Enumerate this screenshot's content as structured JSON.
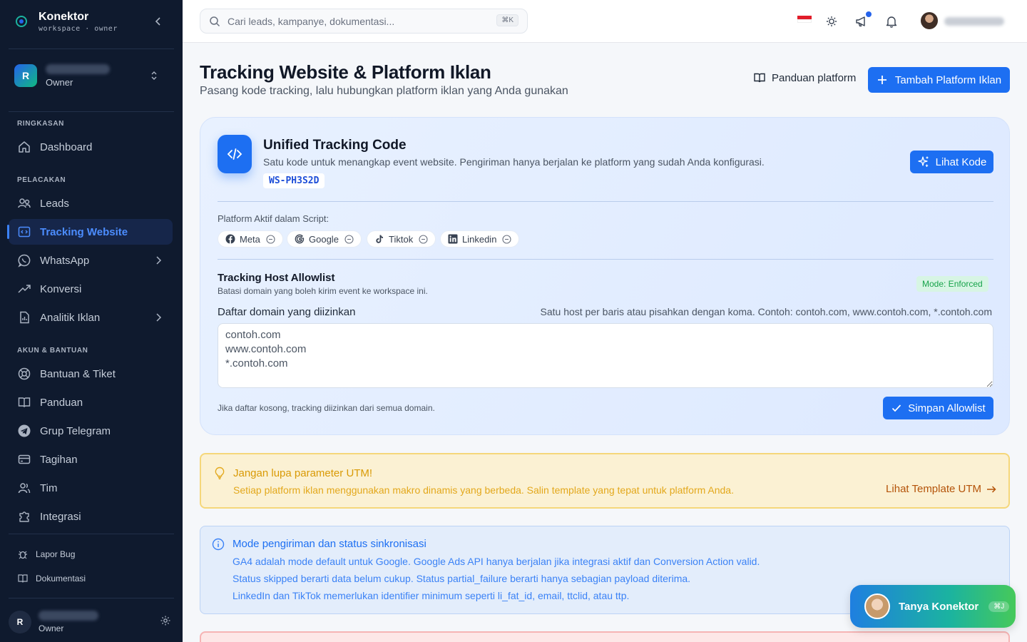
{
  "brand": {
    "name": "Konektor",
    "sub": "workspace · owner"
  },
  "workspace": {
    "initial": "R",
    "role": "Owner"
  },
  "sidebar": {
    "sections": [
      "RINGKASAN",
      "PELACAKAN",
      "AKUN & BANTUAN"
    ],
    "items": [
      {
        "label": "Dashboard",
        "icon": "home-icon"
      },
      {
        "label": "Leads",
        "icon": "users-icon"
      },
      {
        "label": "Tracking Website",
        "icon": "code-icon",
        "active": true
      },
      {
        "label": "WhatsApp",
        "icon": "whatsapp-icon"
      },
      {
        "label": "Konversi",
        "icon": "trend-icon"
      },
      {
        "label": "Analitik Iklan",
        "icon": "file-chart-icon"
      },
      {
        "label": "Bantuan & Tiket",
        "icon": "lifebuoy-icon"
      },
      {
        "label": "Panduan",
        "icon": "book-icon"
      },
      {
        "label": "Grup Telegram",
        "icon": "telegram-icon"
      },
      {
        "label": "Tagihan",
        "icon": "card-icon"
      },
      {
        "label": "Tim",
        "icon": "team-icon"
      },
      {
        "label": "Integrasi",
        "icon": "puzzle-icon"
      }
    ],
    "footer": [
      {
        "label": "Lapor Bug",
        "icon": "bug-icon"
      },
      {
        "label": "Dokumentasi",
        "icon": "book-icon"
      }
    ],
    "user": {
      "initial": "R",
      "role": "Owner"
    }
  },
  "topbar": {
    "search_placeholder": "Cari leads, kampanye, dokumentasi...",
    "search_kbd": "⌘K"
  },
  "page": {
    "title": "Tracking Website & Platform Iklan",
    "subtitle": "Pasang kode tracking, lalu hubungkan platform iklan yang Anda gunakan",
    "guide_label": "Panduan platform",
    "add_label": "Tambah Platform Iklan"
  },
  "utc": {
    "title": "Unified Tracking Code",
    "desc": "Satu kode untuk menangkap event website. Pengiriman hanya berjalan ke platform yang sudah Anda konfigurasi.",
    "code": "WS-PH3S2D",
    "view_label": "Lihat Kode",
    "platforms_label": "Platform Aktif dalam Script:",
    "platforms": [
      "Meta",
      "Google",
      "Tiktok",
      "Linkedin"
    ]
  },
  "allowlist": {
    "title": "Tracking Host Allowlist",
    "desc": "Batasi domain yang boleh kirim event ke workspace ini.",
    "mode": "Mode: Enforced",
    "label": "Daftar domain yang diizinkan",
    "hint": "Satu host per baris atau pisahkan dengan koma. Contoh: contoh.com, www.contoh.com, *.contoh.com",
    "value": "contoh.com\nwww.contoh.com\n*.contoh.com",
    "empty_note": "Jika daftar kosong, tracking diizinkan dari semua domain.",
    "save_label": "Simpan Allowlist"
  },
  "utm": {
    "title": "Jangan lupa parameter UTM!",
    "desc": "Setiap platform iklan menggunakan makro dinamis yang berbeda. Salin template yang tepat untuk platform Anda.",
    "link": "Lihat Template UTM"
  },
  "info": {
    "title": "Mode pengiriman dan status sinkronisasi",
    "lines": [
      "GA4 adalah mode default untuk Google. Google Ads API hanya berjalan jika integrasi aktif dan Conversion Action valid.",
      "Status skipped berarti data belum cukup. Status partial_failure berarti hanya sebagian payload diterima.",
      "LinkedIn dan TikTok memerlukan identifier minimum seperti li_fat_id, email, ttclid, atau ttp."
    ]
  },
  "assistant": {
    "label": "Tanya Konektor",
    "kbd": "⌘J"
  },
  "colors": {
    "sidebar": "#0f1a2e",
    "accent": "#1d6ff2",
    "active_text": "#4c8dff",
    "warning": "#d99a06",
    "success": "#16a34a"
  }
}
